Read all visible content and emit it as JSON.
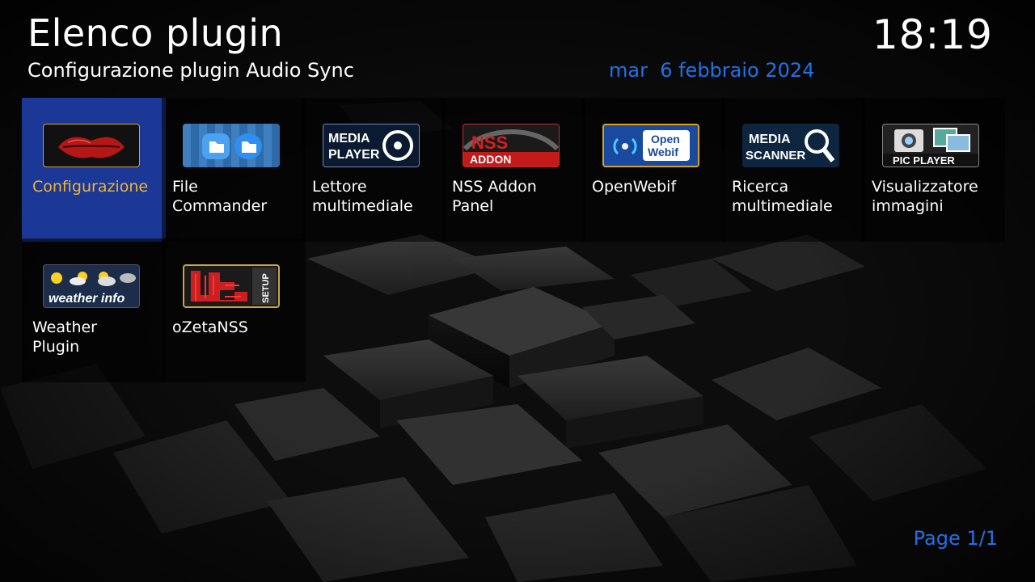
{
  "header": {
    "title": "Elenco plugin",
    "subtitle": "Configurazione plugin Audio Sync",
    "date": "mar  6 febbraio 2024",
    "time": "18:19"
  },
  "footer": {
    "page_indicator": "Page 1/1"
  },
  "plugins": [
    {
      "label": "Configurazione",
      "icon": "lips-icon",
      "selected": true
    },
    {
      "label": "File\nCommander",
      "icon": "folder-icon",
      "selected": false
    },
    {
      "label": "Lettore\nmultimediale",
      "icon": "media-player-icon",
      "icon_text": [
        "MEDIA",
        "PLAYER"
      ],
      "selected": false
    },
    {
      "label": "NSS Addon\nPanel",
      "icon": "nss-addon-icon",
      "icon_text": [
        "NSS",
        "ADDON"
      ],
      "selected": false
    },
    {
      "label": "OpenWebif",
      "icon": "openwebif-icon",
      "icon_text": [
        "Open",
        "Webif"
      ],
      "selected": false
    },
    {
      "label": "Ricerca\nmultimediale",
      "icon": "media-scanner-icon",
      "icon_text": [
        "MEDIA",
        "SCANNER"
      ],
      "selected": false
    },
    {
      "label": "Visualizzatore\n immagini",
      "icon": "pic-player-icon",
      "icon_text": [
        "PIC PLAYER"
      ],
      "selected": false
    },
    {
      "label": "Weather\nPlugin",
      "icon": "weather-icon",
      "icon_text": [
        "weather info"
      ],
      "selected": false
    },
    {
      "label": "oZetaNSS",
      "icon": "ozeta-setup-icon",
      "icon_text": [
        "SETUP"
      ],
      "selected": false
    }
  ],
  "colors": {
    "accent_blue": "#1e73e8",
    "selection_bg": "#1c3896",
    "selected_text": "#f0b431"
  }
}
